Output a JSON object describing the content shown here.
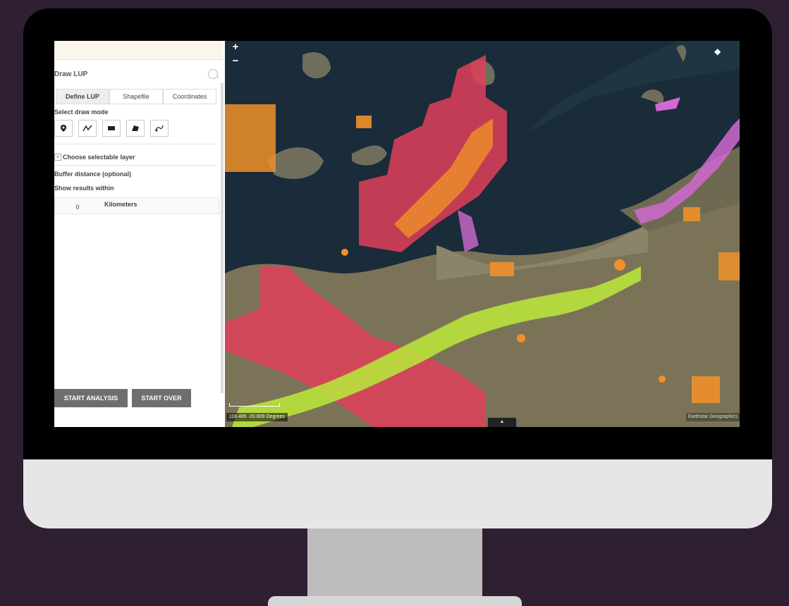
{
  "panel": {
    "title": "Draw LUP",
    "tabs": [
      "Define LUP",
      "Shapefile",
      "Coordinates"
    ],
    "draw_mode_label": "Select draw mode",
    "choose_layer_label": "Choose selectable layer",
    "buffer_label": "Buffer distance (optional)",
    "show_results_label": "Show results within",
    "distance_value": "0",
    "distance_unit": "Kilometers",
    "start_analysis": "START ANALYSIS",
    "start_over": "START OVER"
  },
  "map": {
    "zoom_in": "+",
    "zoom_out": "−",
    "coordinates": "116.465 -20.609 Degrees",
    "attribution": "Earthstar Geographics",
    "colors": {
      "water": "#1a2b3a",
      "land": "#7a7358",
      "red_zone": "#e0405a",
      "orange_zone": "#f0902a",
      "green_corridor": "#b7e03c",
      "magenta_zone": "#d06ad0"
    }
  },
  "icons": {
    "draw_tools": [
      "point-icon",
      "polyline-icon",
      "rectangle-icon",
      "polygon-icon",
      "freehand-icon"
    ]
  }
}
